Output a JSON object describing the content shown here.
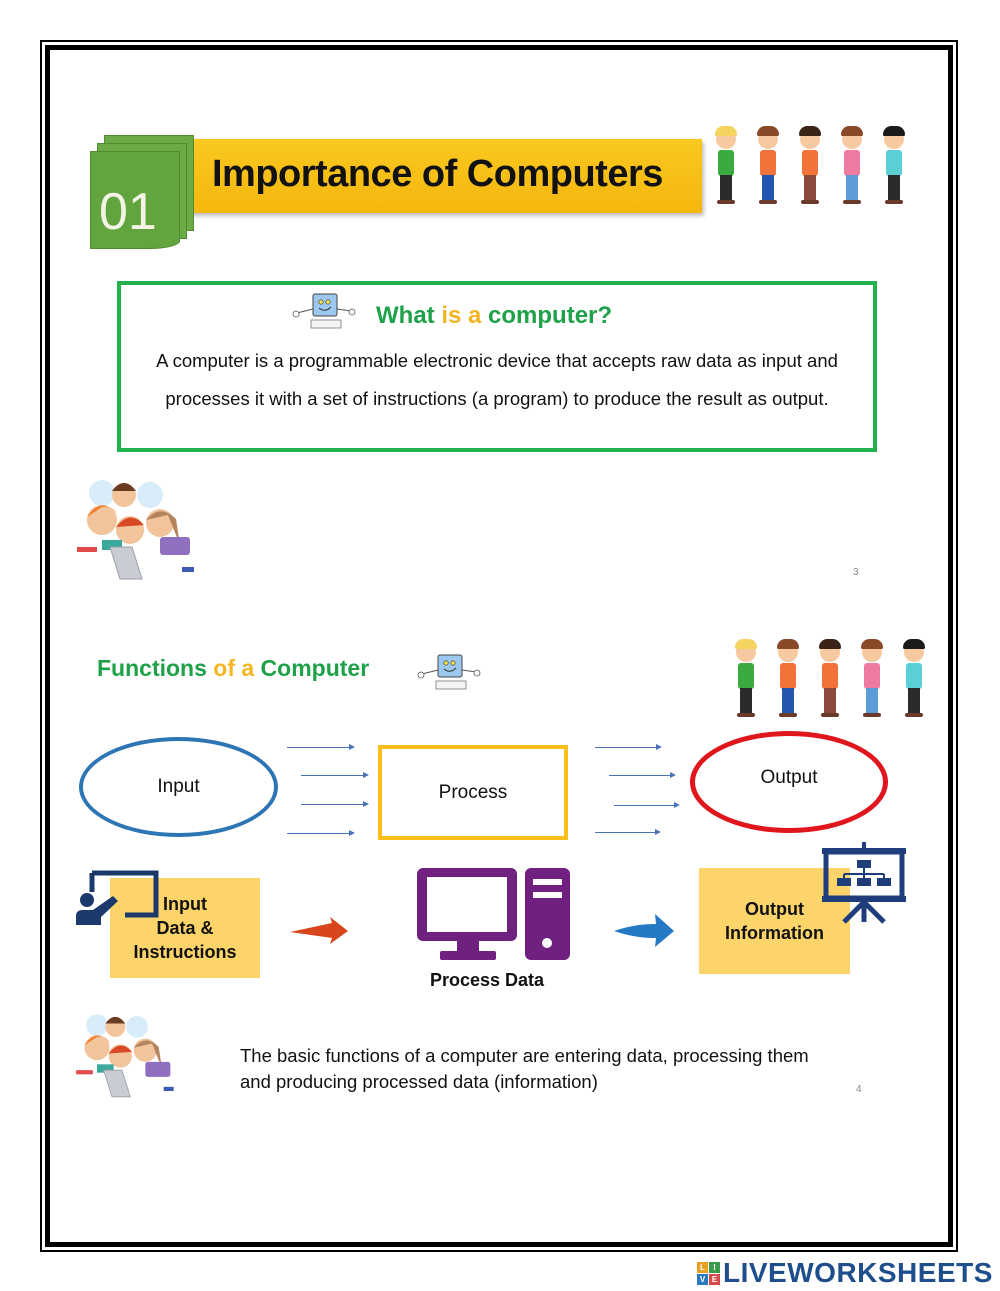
{
  "header": {
    "section_number": "01",
    "title": "Importance of Computers"
  },
  "definition": {
    "heading_part1": "What ",
    "heading_part2": "is a",
    "heading_part3": " computer?",
    "line1": "A computer is a programmable electronic device that accepts raw data as input and",
    "line2": "processes it with a set of instructions (a program) to produce the result as output."
  },
  "page_numbers": [
    "3",
    "4"
  ],
  "functions": {
    "title_part1": "Functions ",
    "title_part2": "of a",
    "title_part3": " Computer",
    "cycle": {
      "input": "Input",
      "process": "Process",
      "output": "Output"
    },
    "flow": {
      "input_box": [
        "Input",
        "Data &",
        "Instructions"
      ],
      "process_label": "Process Data",
      "output_box": [
        "Output",
        "Information"
      ]
    },
    "summary_line1": "The basic functions of a computer are entering data, processing them",
    "summary_line2": "and producing processed data (information)"
  },
  "colors": {
    "green_heading": "#1ea149",
    "yellow_accent": "#f4b522",
    "input_blue": "#2e75b6",
    "output_red": "#e0161d",
    "process_yellow": "#f9be19",
    "purple_computer": "#70217f",
    "navy_icon": "#1f3d7a"
  },
  "kids": [
    {
      "hair": "#f4d35e",
      "shirt": "#3cab3f",
      "pants": "#2b2b2b"
    },
    {
      "hair": "#8a4a2a",
      "shirt": "#f2733a",
      "pants": "#2456b0"
    },
    {
      "hair": "#3a2418",
      "shirt": "#f2733a",
      "pants": "#8a4b3c"
    },
    {
      "hair": "#8a4a2a",
      "shirt": "#f07aa0",
      "pants": "#5b9bd8"
    },
    {
      "hair": "#1a1a1a",
      "shirt": "#5ad0d6",
      "pants": "#2b2b2b"
    }
  ],
  "footer": {
    "logo_badge": [
      "L",
      "I",
      "V",
      "E"
    ],
    "logo_text": "LIVEWORKSHEETS"
  }
}
